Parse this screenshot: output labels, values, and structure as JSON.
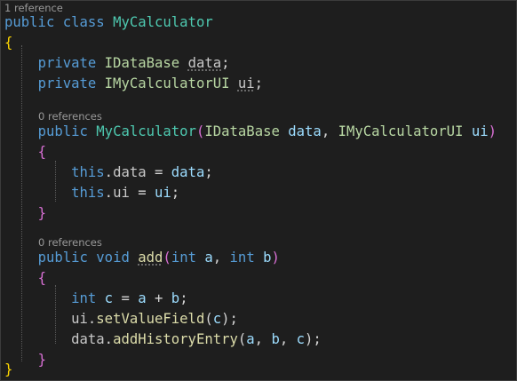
{
  "code_lens": {
    "class_refs": "1 reference",
    "ctor_refs": "0 references",
    "add_refs": "0 references"
  },
  "code": {
    "kw_public": "public",
    "kw_class": "class",
    "kw_private": "private",
    "kw_this": "this",
    "kw_void": "void",
    "kw_int": "int",
    "class_name": "MyCalculator",
    "type_idatabase": "IDataBase",
    "type_iui": "IMyCalculatorUI",
    "field_data": "data",
    "field_ui": "ui",
    "param_data": "data",
    "param_ui": "ui",
    "method_add": "add",
    "param_a": "a",
    "param_b": "b",
    "local_c": "c",
    "call_setvalue": "setValueField",
    "call_addhistory": "addHistoryEntry"
  },
  "colors": {
    "background": "#1e1e1e",
    "keyword": "#569cd6",
    "type": "#4ec9b0",
    "interface": "#b8d7a3",
    "method": "#dcdcaa",
    "parameter": "#9cdcfe",
    "codelens": "#999999"
  }
}
